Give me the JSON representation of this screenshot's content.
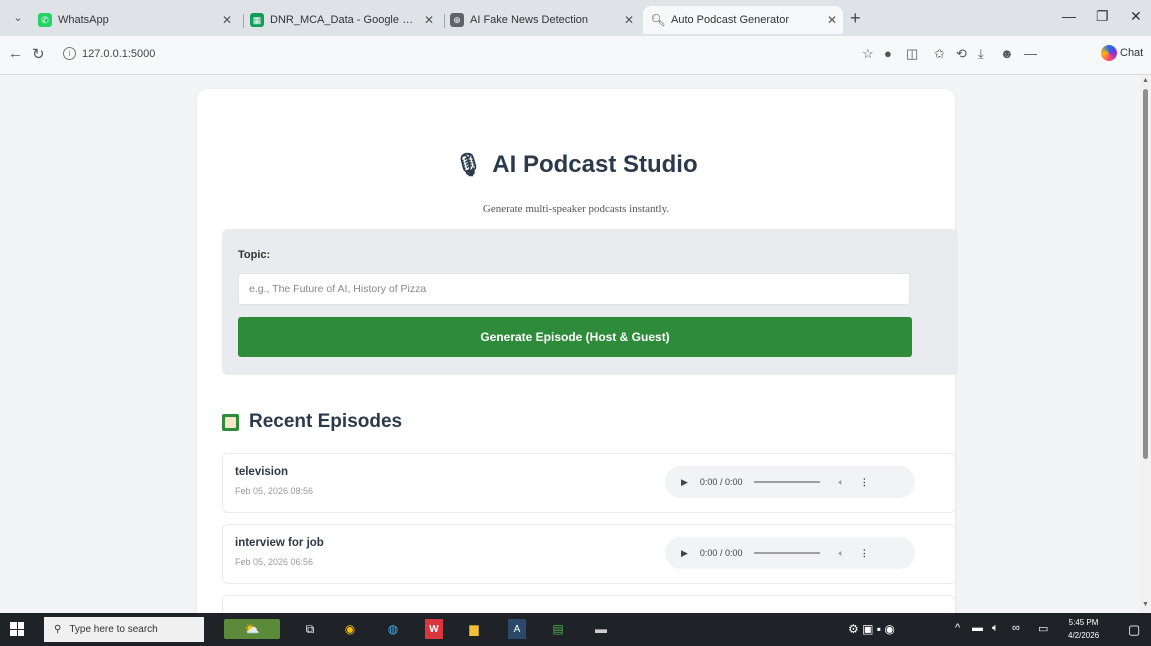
{
  "browser": {
    "tabs": [
      {
        "title": "WhatsApp",
        "icon": "whatsapp-icon",
        "color": "#25d366"
      },
      {
        "title": "DNR_MCA_Data - Google Sheets",
        "icon": "sheets-icon",
        "color": "#0f9d58"
      },
      {
        "title": "AI Fake News Detection",
        "icon": "globe-icon",
        "color": "#5f6368"
      },
      {
        "title": "Auto Podcast Generator",
        "icon": "search-icon",
        "color": "#5f6368",
        "active": true
      }
    ],
    "url": "127.0.0.1:5000",
    "chat_label": "Chat"
  },
  "page": {
    "title": "AI Podcast Studio",
    "subtitle": "Generate multi-speaker podcasts instantly.",
    "form": {
      "topic_label": "Topic:",
      "topic_placeholder": "e.g., The Future of AI, History of Pizza",
      "topic_value": "",
      "generate_label": "Generate Episode (Host & Guest)"
    },
    "recent_heading": "Recent Episodes",
    "episodes": [
      {
        "title": "television",
        "date": "Feb 05, 2026 08:56",
        "time": "0:00 / 0:00"
      },
      {
        "title": "interview for job",
        "date": "Feb 05, 2026 06:56",
        "time": "0:00 / 0:00"
      }
    ]
  },
  "taskbar": {
    "search_placeholder": "Type here to search",
    "time": "5:45 PM",
    "date": "4/2/2026"
  },
  "colors": {
    "accent_green": "#2e8b3a",
    "title_color": "#2b3a4a",
    "page_bg": "#f3f4f6"
  }
}
